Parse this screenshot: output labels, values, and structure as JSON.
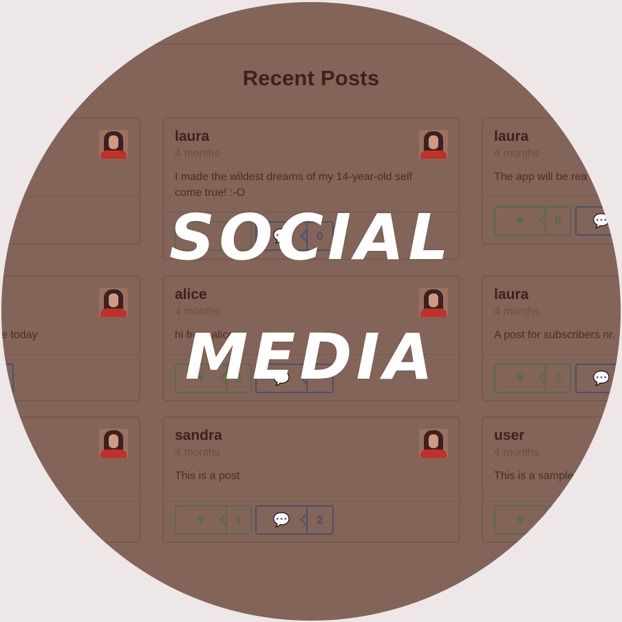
{
  "page": {
    "heading": "Recent Posts"
  },
  "overlay": {
    "line1": "SOCIAL",
    "line2": "MEDIA"
  },
  "posts": [
    {
      "author": "",
      "time": "",
      "text": "",
      "likes": "",
      "comments": ""
    },
    {
      "author": "laura",
      "time": "4 months",
      "text": "I made the wildest dreams of my 14-year-old self come true! :-O",
      "likes": "",
      "comments": "0"
    },
    {
      "author": "laura",
      "time": "4 months",
      "text": "The app will be rea",
      "likes": "0",
      "comments": ""
    },
    {
      "author": "",
      "time": "",
      "text": "e today",
      "likes": "",
      "comments": ""
    },
    {
      "author": "alice",
      "time": "4 months",
      "text": "hi from alice",
      "likes": "2",
      "comments": ""
    },
    {
      "author": "laura",
      "time": "4 months",
      "text": "A post for subscribers nr.",
      "likes": "3",
      "comments": ""
    },
    {
      "author": "",
      "time": "",
      "text": "",
      "likes": "",
      "comments": ""
    },
    {
      "author": "sandra",
      "time": "4 months",
      "text": "This is a post",
      "likes": "1",
      "comments": "2"
    },
    {
      "author": "user",
      "time": "4 months",
      "text": "This is a sample",
      "likes": "",
      "comments": ""
    }
  ],
  "icons": {
    "like": "heart-icon",
    "comment": "comments-icon",
    "avatar": "avatar-image"
  },
  "colors": {
    "background": "#ede7e8",
    "disc": "#836458",
    "like": "#5a6a48",
    "comment": "#4c4f6c"
  }
}
